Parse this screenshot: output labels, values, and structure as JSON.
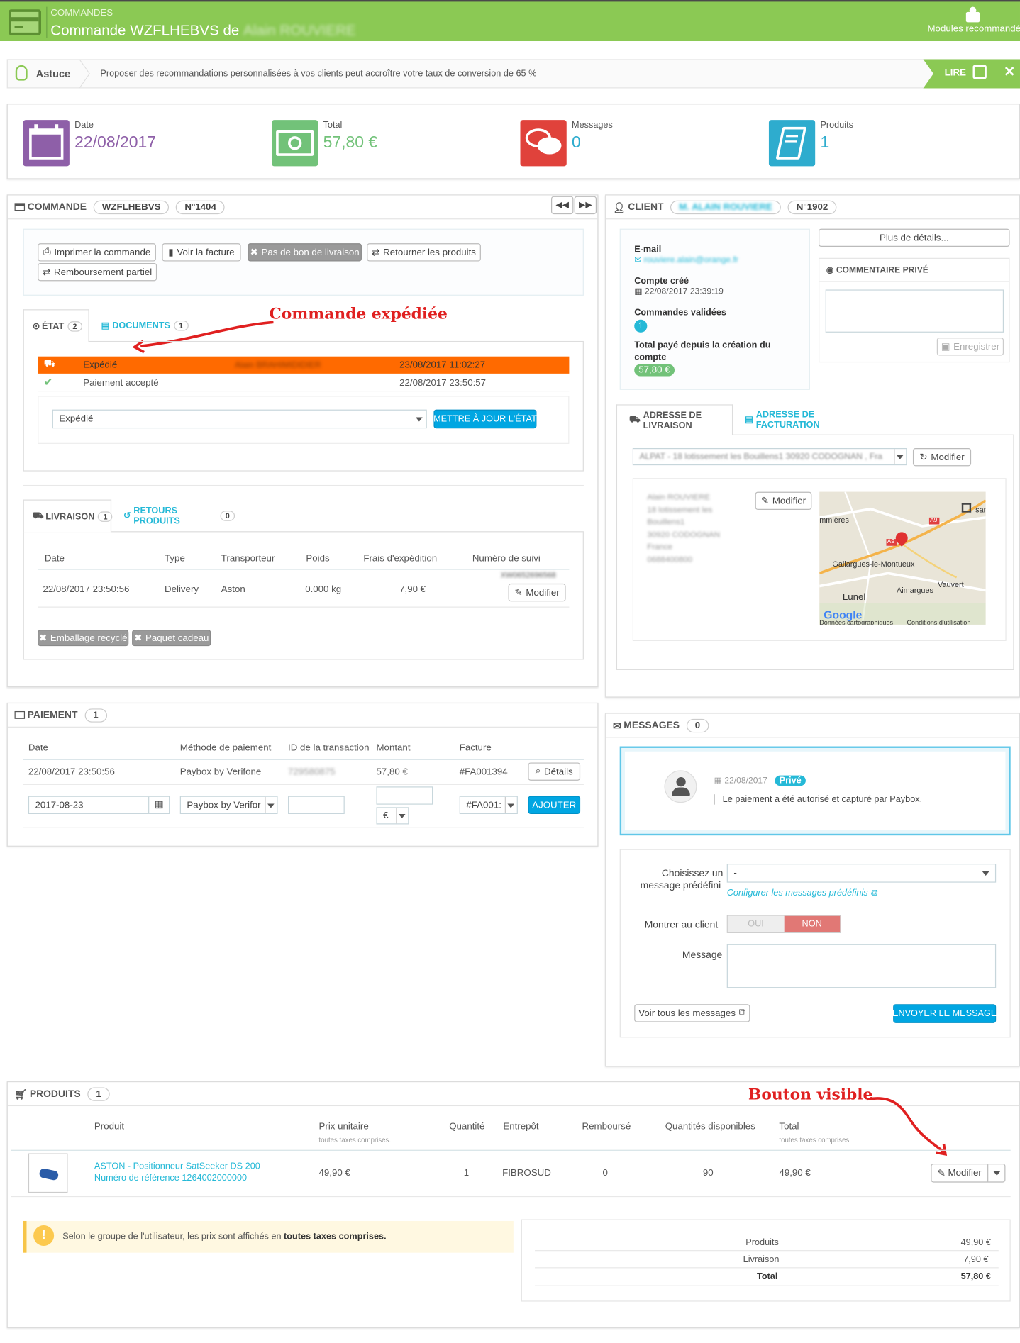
{
  "header": {
    "breadcrumb": "COMMANDES",
    "title_prefix": "Commande WZFLHEBVS de",
    "customer_name": "Alain ROUVIERE",
    "modules_label": "Modules recommandés"
  },
  "tip": {
    "label": "Astuce",
    "text": "Proposer des recommandations personnalisées à vos clients peut accroître votre taux de conversion de 65 %",
    "read_label": "LIRE"
  },
  "kpis": [
    {
      "label": "Date",
      "value": "22/08/2017",
      "color": "#8e5fa8"
    },
    {
      "label": "Total",
      "value": "57,80 €",
      "color": "#72c279"
    },
    {
      "label": "Messages",
      "value": "0",
      "color": "#e0423b"
    },
    {
      "label": "Produits",
      "value": "1",
      "color": "#2eacce"
    }
  ],
  "order": {
    "section": "COMMANDE",
    "ref": "WZFLHEBVS",
    "number": "N°1404",
    "buttons": {
      "print": "Imprimer la commande",
      "invoice": "Voir la facture",
      "no_delivery_slip": "Pas de bon de livraison",
      "return": "Retourner les produits",
      "partial_refund": "Remboursement partiel"
    },
    "tabs": {
      "state": "ÉTAT",
      "state_count": "2",
      "documents": "DOCUMENTS",
      "documents_count": "1"
    },
    "history": [
      {
        "state": "Expédié",
        "employee": "Alain BRAHIMIDIDIER",
        "date": "23/08/2017 11:02:27"
      },
      {
        "state": "Paiement accepté",
        "employee": "",
        "date": "22/08/2017 23:50:57"
      }
    ],
    "state_select": "Expédié",
    "update_label": "METTRE À JOUR L'ÉTAT",
    "annotation": "Commande expédiée"
  },
  "shipping": {
    "tab": "LIVRAISON",
    "tab_count": "1",
    "returns_tab": "RETOURS PRODUITS",
    "returns_count": "0",
    "columns": [
      "Date",
      "Type",
      "Transporteur",
      "Poids",
      "Frais d'expédition",
      "Numéro de suivi"
    ],
    "row": {
      "date": "22/08/2017 23:50:56",
      "type": "Delivery",
      "carrier": "Aston",
      "weight": "0.000 kg",
      "fees": "7,90 €",
      "tracking": "XW0652696568"
    },
    "modify": "Modifier",
    "recycled": "Emballage recyclé",
    "gift": "Paquet cadeau"
  },
  "client": {
    "section": "CLIENT",
    "name": "M. ALAIN ROUVIERE",
    "number": "N°1902",
    "email_label": "E-mail",
    "email": "rouviere.alain@orange.fr",
    "created_label": "Compte créé",
    "created": "22/08/2017 23:39:19",
    "orders_label": "Commandes validées",
    "orders": "1",
    "paid_label": "Total payé depuis la création du compte",
    "paid": "57,80 €",
    "details_btn": "Plus de détails...",
    "private_note": "COMMENTAIRE PRIVÉ",
    "save": "Enregistrer"
  },
  "address": {
    "tab_delivery": "ADRESSE DE LIVRAISON",
    "tab_invoice": "ADRESSE DE FACTURATION",
    "select": "ALPAT - 18 lotissement les Bouillens1 30920 CODOGNAN , Fra",
    "modify": "Modifier",
    "lines": [
      "Alain ROUVIERE",
      "18 lotissement les",
      "Bouillens1",
      "30920 CODOGNAN",
      "France",
      "0688400800"
    ],
    "map": {
      "places": [
        "mmières",
        "Gallargues-le-Montueux",
        "Aimargues",
        "Vauvert",
        "Lunel",
        "sar"
      ],
      "roads": [
        "A9",
        "A9"
      ],
      "google": "Google",
      "footer1": "Données cartographiques",
      "footer2": "Conditions d'utilisation"
    }
  },
  "payment": {
    "section": "PAIEMENT",
    "count": "1",
    "columns": [
      "Date",
      "Méthode de paiement",
      "ID de la transaction",
      "Montant",
      "Facture"
    ],
    "row": {
      "date": "22/08/2017 23:50:56",
      "method": "Paybox by Verifone",
      "transaction": "729580875",
      "amount": "57,80 €",
      "invoice": "#FA001394",
      "details": "Détails"
    },
    "form": {
      "date": "2017-08-23",
      "method": "Paybox by Verifor",
      "currency": "€",
      "invoice": "#FA001:",
      "add": "AJOUTER"
    }
  },
  "messages": {
    "section": "MESSAGES",
    "count": "0",
    "msg_date": "22/08/2017 -",
    "private": "Privé",
    "msg_text": "Le paiement a été autorisé et capturé par Paybox.",
    "predefined_label1": "Choisissez un",
    "predefined_label2": "message prédéfini",
    "predefined_value": "-",
    "configure": "Configurer les messages prédéfinis",
    "show_client": "Montrer au client",
    "yes": "OUI",
    "no": "NON",
    "message_label": "Message",
    "view_all": "Voir tous les messages",
    "send": "ENVOYER LE MESSAGE"
  },
  "products": {
    "section": "PRODUITS",
    "count": "1",
    "columns": [
      "Produit",
      "Prix unitaire",
      "Quantité",
      "Entrepôt",
      "Remboursé",
      "Quantités disponibles",
      "Total"
    ],
    "tax_note": "toutes taxes comprises.",
    "row": {
      "name": "ASTON - Positionneur SatSeeker DS 200",
      "reference": "Numéro de référence 1264002000000",
      "price": "49,90 €",
      "qty": "1",
      "warehouse": "FIBROSUD",
      "refunded": "0",
      "available": "90",
      "total": "49,90 €",
      "modify": "Modifier"
    },
    "annotation": "Bouton visible",
    "notice_prefix": "Selon le groupe de l'utilisateur, les prix sont affichés en",
    "notice_bold": "toutes taxes comprises.",
    "totals": [
      {
        "label": "Produits",
        "value": "49,90 €"
      },
      {
        "label": "Livraison",
        "value": "7,90 €"
      },
      {
        "label": "Total",
        "value": "57,80 €"
      }
    ]
  },
  "colors": {
    "header": "#8bc954",
    "accent": "#25b9d7",
    "shipped": "#ff6a00",
    "message_border": "#60c7e8",
    "no_active": "#e17875"
  }
}
